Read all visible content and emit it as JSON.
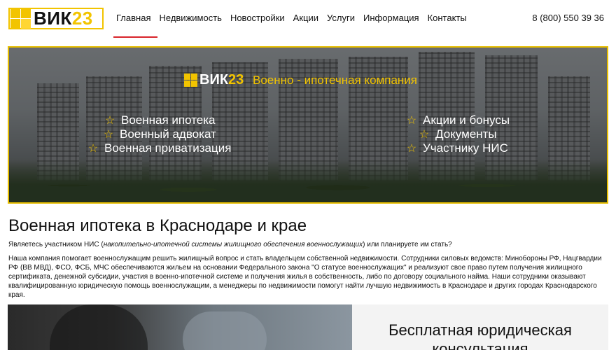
{
  "header": {
    "logo": {
      "text_main": "ВИК",
      "text_num": "23"
    },
    "nav": [
      {
        "label": "Главная",
        "active": true
      },
      {
        "label": "Недвижимость",
        "active": false
      },
      {
        "label": "Новостройки",
        "active": false
      },
      {
        "label": "Акции",
        "active": false
      },
      {
        "label": "Услуги",
        "active": false
      },
      {
        "label": "Информация",
        "active": false
      },
      {
        "label": "Контакты",
        "active": false
      }
    ],
    "phone": "8 (800) 550 39 36"
  },
  "banner": {
    "brand_main": "ВИК",
    "brand_num": "23",
    "tagline": "Военно - ипотечная компания",
    "left_items": [
      "Военная ипотека",
      "Военный адвокат",
      "Военная приватизация"
    ],
    "right_items": [
      "Акции и бонусы",
      "Документы",
      "Участнику НИС"
    ],
    "star_icon": "☆"
  },
  "main": {
    "title": "Военная ипотека в Краснодаре и крае",
    "intro_before": "Являетесь участником НИС (",
    "intro_em": "накопительно-ипотечной системы жилищного обеспечения военнослужащих",
    "intro_after": ") или планируете им стать?",
    "description": "Наша компания помогает военнослужащим решить жилищный вопрос и стать владельцем собственной недвижимости. Сотрудники силовых ведомств: Минобороны РФ, Нацгвардии РФ (ВВ МВД), ФСО, ФСБ, МЧС обеспечиваются жильем на основании Федерального закона \"О статусе военнослужащих\" и реализуют свое право путем получения жилищного сертификата, денежной субсидии, участия в военно-ипотечной системе и получения жилья в собственность, либо по договору социального найма. Наши сотрудники оказывают квалифицированную юридическую помощь военнослужащим, а менеджеры по недвижимости помогут найти лучшую недвижимость в Краснодаре и других городах Краснодарского края."
  },
  "consult": {
    "title_line1": "Бесплатная юридическая",
    "title_line2": "консультация"
  },
  "colors": {
    "accent": "#f2c400",
    "nav_active": "#d8242a"
  }
}
